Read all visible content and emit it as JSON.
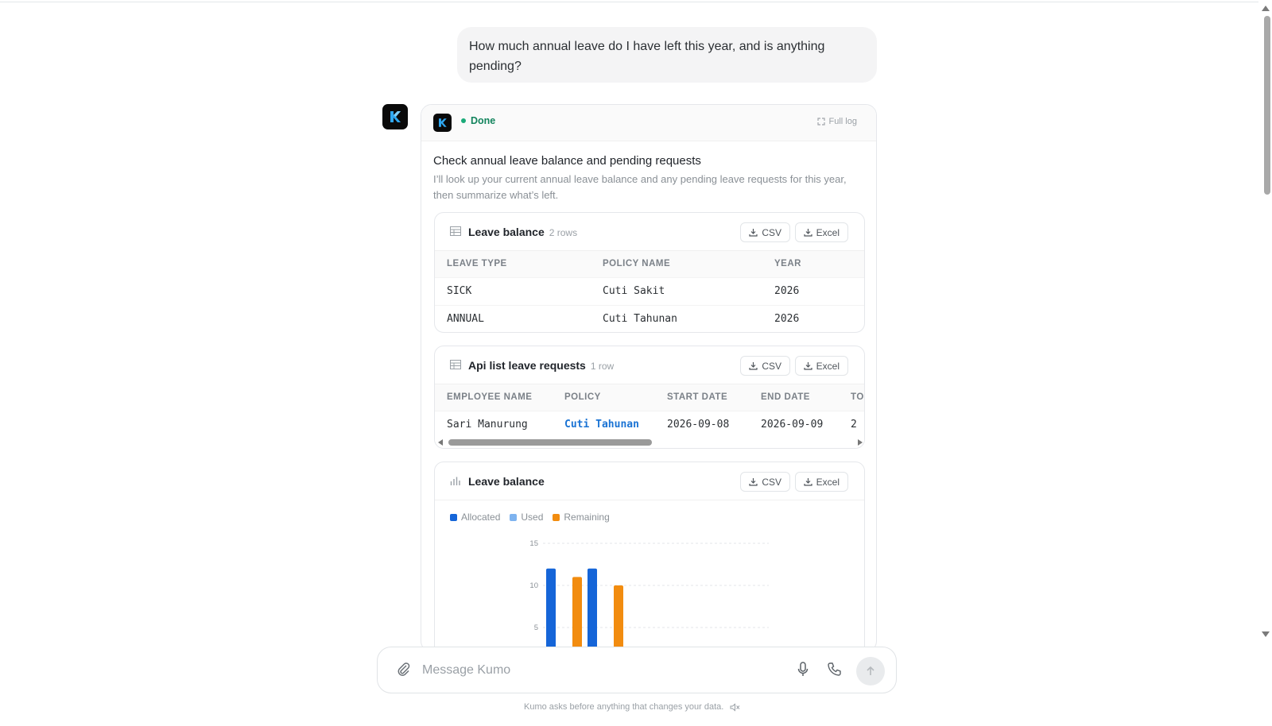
{
  "user_message": "How much annual leave do I have left this year, and is anything pending?",
  "assistant": {
    "status": "Done",
    "full_log_label": "Full log",
    "task_title": "Check annual leave balance and pending requests",
    "task_description": "I’ll look up your current annual leave balance and any pending leave requests for this year, then summarize what’s left."
  },
  "buttons": {
    "csv": "CSV",
    "excel": "Excel"
  },
  "leave_balance_table": {
    "title": "Leave balance",
    "count": "2 rows",
    "columns": [
      "LEAVE TYPE",
      "POLICY NAME",
      "YEAR"
    ],
    "rows": [
      [
        "SICK",
        "Cuti Sakit",
        "2026"
      ],
      [
        "ANNUAL",
        "Cuti Tahunan",
        "2026"
      ]
    ]
  },
  "leave_requests_table": {
    "title": "Api list leave requests",
    "count": "1 row",
    "columns": [
      "EMPLOYEE NAME",
      "POLICY",
      "START DATE",
      "END DATE",
      "TO"
    ],
    "rows": [
      [
        "Sari Manurung",
        "Cuti Tahunan",
        "2026-09-08",
        "2026-09-09",
        "2"
      ]
    ]
  },
  "chart_title": "Leave balance",
  "chart_data": {
    "type": "bar",
    "categories": [
      "",
      ""
    ],
    "series": [
      {
        "name": "Allocated",
        "values": [
          12,
          12
        ],
        "color": "#1565d8"
      },
      {
        "name": "Used",
        "values": [
          0,
          0
        ],
        "color": "#7eb3ef"
      },
      {
        "name": "Remaining",
        "values": [
          11,
          10
        ],
        "color": "#f28c0f"
      }
    ],
    "y_ticks": [
      "15",
      "10",
      "5"
    ],
    "ylim": [
      0,
      15
    ],
    "grid": true,
    "legend": "top-left"
  },
  "composer": {
    "placeholder": "Message Kumo",
    "footnote": "Kumo asks before anything that changes your data."
  }
}
